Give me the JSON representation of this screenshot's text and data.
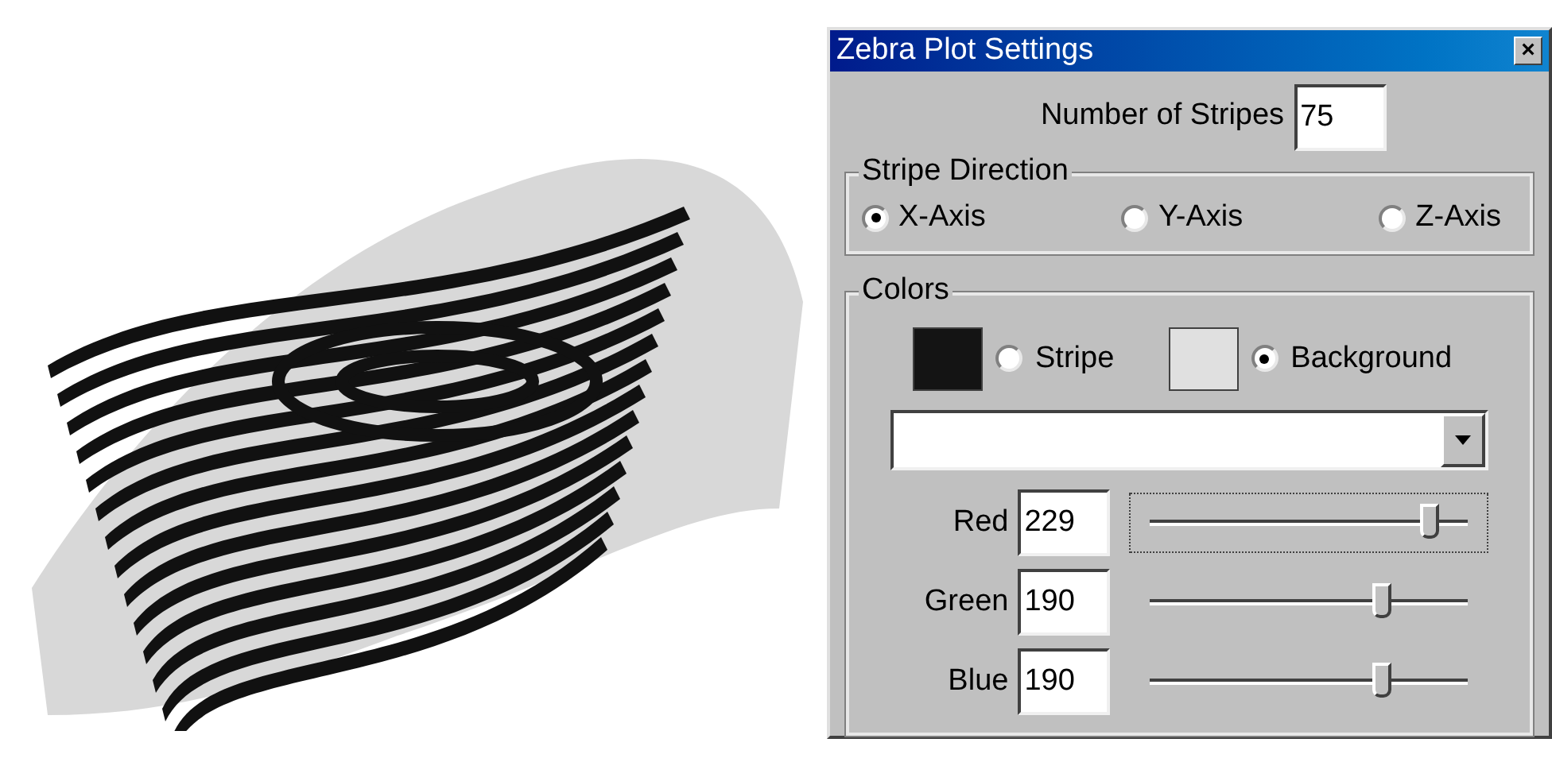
{
  "dialog": {
    "title": "Zebra Plot Settings",
    "close": "×"
  },
  "stripes": {
    "label": "Number of Stripes",
    "value": "75"
  },
  "direction": {
    "title": "Stripe Direction",
    "options": [
      {
        "label": "X-Axis",
        "selected": true
      },
      {
        "label": "Y-Axis",
        "selected": false
      },
      {
        "label": "Z-Axis",
        "selected": false
      }
    ]
  },
  "colors": {
    "title": "Colors",
    "targets": [
      {
        "label": "Stripe",
        "color": "#141414",
        "selected": false
      },
      {
        "label": "Background",
        "color": "#e0e0e0",
        "selected": true
      }
    ],
    "channels": [
      {
        "label": "Red",
        "value": "229",
        "level": 0.88,
        "focused": true
      },
      {
        "label": "Green",
        "value": "190",
        "level": 0.73,
        "focused": false
      },
      {
        "label": "Blue",
        "value": "190",
        "level": 0.73,
        "focused": false
      }
    ]
  }
}
